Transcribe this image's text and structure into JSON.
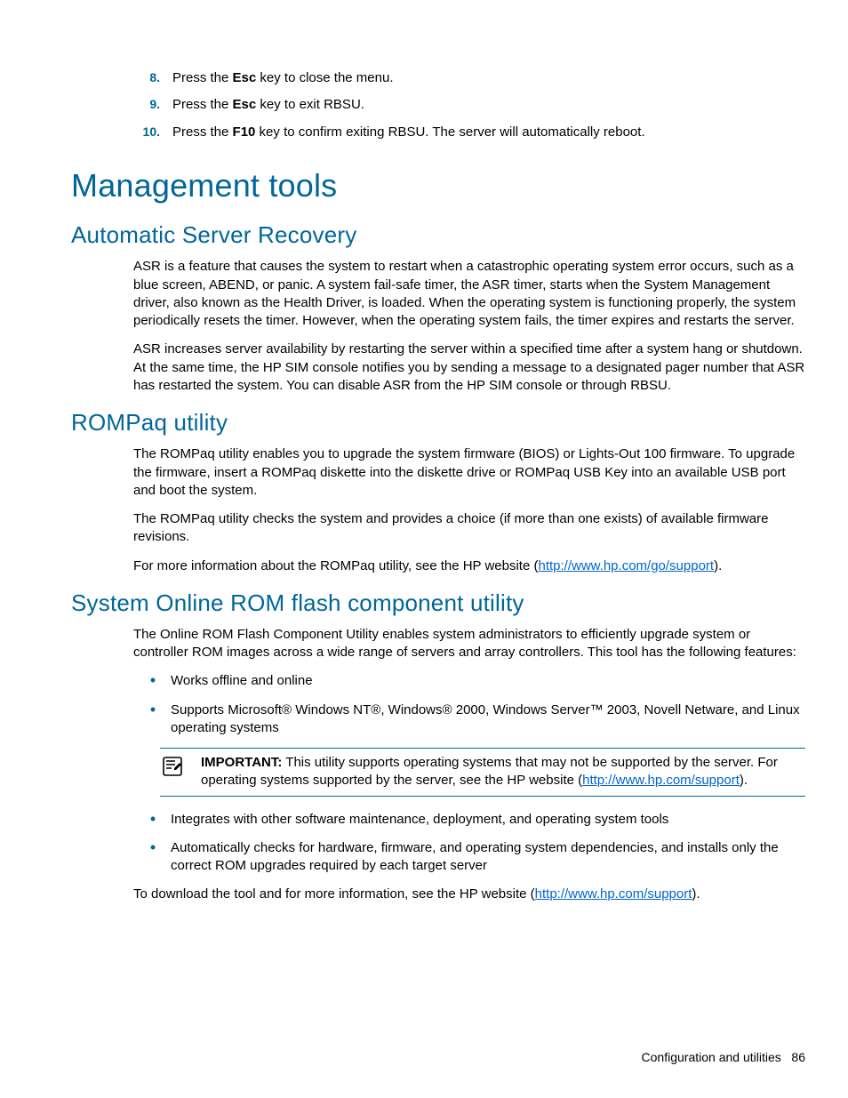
{
  "steps": [
    {
      "n": "8.",
      "pre": "Press the ",
      "key": "Esc",
      "post": " key to close the menu."
    },
    {
      "n": "9.",
      "pre": "Press the ",
      "key": "Esc",
      "post": " key to exit RBSU."
    },
    {
      "n": "10.",
      "pre": "Press the ",
      "key": "F10",
      "post": " key to confirm exiting RBSU. The server will automatically reboot."
    }
  ],
  "h1": "Management tools",
  "asr": {
    "heading": "Automatic Server Recovery",
    "p1": "ASR is a feature that causes the system to restart when a catastrophic operating system error occurs, such as a blue screen, ABEND, or panic. A system fail-safe timer, the ASR timer, starts when the System Management driver, also known as the Health Driver, is loaded. When the operating system is functioning properly, the system periodically resets the timer. However, when the operating system fails, the timer expires and restarts the server.",
    "p2": "ASR increases server availability by restarting the server within a specified time after a system hang or shutdown. At the same time, the HP SIM console notifies you by sending a message to a designated pager number that ASR has restarted the system. You can disable ASR from the HP SIM console or through RBSU."
  },
  "rompaq": {
    "heading": "ROMPaq utility",
    "p1": "The ROMPaq utility enables you to upgrade the system firmware (BIOS) or Lights-Out 100 firmware. To upgrade the firmware, insert a ROMPaq diskette into the diskette drive or ROMPaq USB Key into an available USB port and boot the system.",
    "p2": "The ROMPaq utility checks the system and provides a choice (if more than one exists) of available firmware revisions.",
    "p3_pre": "For more information about the ROMPaq utility, see the HP website (",
    "p3_link": "http://www.hp.com/go/support",
    "p3_post": ")."
  },
  "flash": {
    "heading": "System Online ROM flash component utility",
    "intro": "The Online ROM Flash Component Utility enables system administrators to efficiently upgrade system or controller ROM images across a wide range of servers and array controllers. This tool has the following features:",
    "bullets_a": [
      "Works offline and online",
      "Supports Microsoft® Windows NT®, Windows® 2000, Windows Server™ 2003, Novell Netware, and Linux operating systems"
    ],
    "important": {
      "label": "IMPORTANT:",
      "text_pre": "  This utility supports operating systems that may not be supported by the server. For operating systems supported by the server, see the HP website (",
      "link": "http://www.hp.com/support",
      "text_post": ")."
    },
    "bullets_b": [
      "Integrates with other software maintenance, deployment, and operating system tools",
      "Automatically checks for hardware, firmware, and operating system dependencies, and installs only the correct ROM upgrades required by each target server"
    ],
    "outro_pre": "To download the tool and for more information, see the HP website (",
    "outro_link": "http://www.hp.com/support",
    "outro_post": ")."
  },
  "footer": {
    "section": "Configuration and utilities",
    "page": "86"
  }
}
